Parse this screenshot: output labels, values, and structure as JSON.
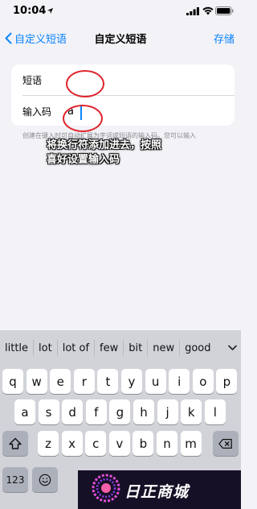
{
  "status_bar": {
    "time": "10:04"
  },
  "nav": {
    "back_label": "自定义短语",
    "title": "自定义短语",
    "save_label": "存储"
  },
  "form": {
    "phrase_label": "短语",
    "phrase_value": "",
    "shortcut_label": "输入码",
    "shortcut_value": "a"
  },
  "helper_text": "创建在键入时可自动扩展为字词或短语的输入码。您可以输入",
  "callout": {
    "line1": "将换行符添加进去，按照",
    "line2": "喜好设置输入码"
  },
  "keyboard": {
    "suggestions": [
      "little",
      "lot",
      "lot of",
      "few",
      "bit",
      "new",
      "good"
    ],
    "row1": [
      "q",
      "w",
      "e",
      "r",
      "t",
      "y",
      "u",
      "i",
      "o",
      "p"
    ],
    "row2": [
      "a",
      "s",
      "d",
      "f",
      "g",
      "h",
      "j",
      "k",
      "l"
    ],
    "row3": [
      "z",
      "x",
      "c",
      "v",
      "b",
      "n",
      "m"
    ],
    "numbers_label": "123"
  },
  "watermark": {
    "text": "日正商城"
  },
  "colors": {
    "accent": "#0a84ff",
    "annotation": "#e0242d"
  }
}
